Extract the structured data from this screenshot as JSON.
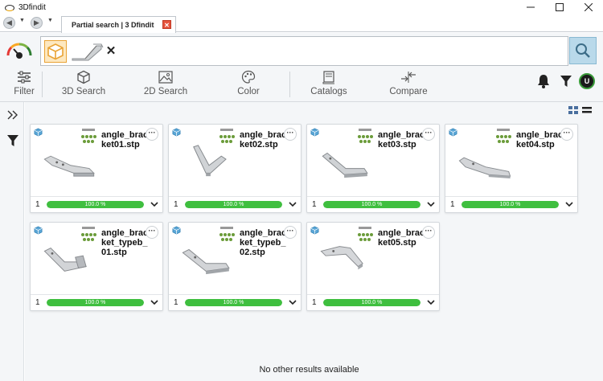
{
  "window": {
    "title": "3Dfindit",
    "controls": [
      "minimize-icon",
      "maximize-icon",
      "close-icon"
    ]
  },
  "tabs": [
    {
      "label": "Partial search | 3 Dfindit",
      "active": true
    }
  ],
  "search": {
    "chips": [
      "cube-icon",
      "bracket-thumbnail"
    ],
    "clear_icon": "close-icon",
    "button_icon": "search-icon"
  },
  "toolbar": {
    "filter": "Filter",
    "search3d": "3D Search",
    "search2d": "2D Search",
    "color": "Color",
    "catalogs": "Catalogs",
    "compare": "Compare",
    "avatar": "U"
  },
  "results": [
    {
      "name": "angle_bracket01.stp",
      "qty": "1",
      "progress": 1.0,
      "progress_label": "100.0 %",
      "shape": "a"
    },
    {
      "name": "angle_bracket02.stp",
      "qty": "1",
      "progress": 1.0,
      "progress_label": "100.0 %",
      "shape": "b"
    },
    {
      "name": "angle_bracket03.stp",
      "qty": "1",
      "progress": 1.0,
      "progress_label": "100.0 %",
      "shape": "c"
    },
    {
      "name": "angle_bracket04.stp",
      "qty": "1",
      "progress": 1.0,
      "progress_label": "100.0 %",
      "shape": "d"
    },
    {
      "name": "angle_bracket_typeb_01.stp",
      "qty": "1",
      "progress": 1.0,
      "progress_label": "100.0 %",
      "shape": "e"
    },
    {
      "name": "angle_bracket_typeb_02.stp",
      "qty": "1",
      "progress": 1.0,
      "progress_label": "100.0 %",
      "shape": "f"
    },
    {
      "name": "angle_bracket05.stp",
      "qty": "1",
      "progress": 1.0,
      "progress_label": "100.0 %",
      "shape": "g"
    }
  ],
  "status": {
    "no_more": "No other results available"
  },
  "colors": {
    "accent_orange": "#e9a335",
    "progress_green": "#3fbf3f",
    "search_button": "#b9d9ea",
    "background": "#f4f6f8"
  }
}
